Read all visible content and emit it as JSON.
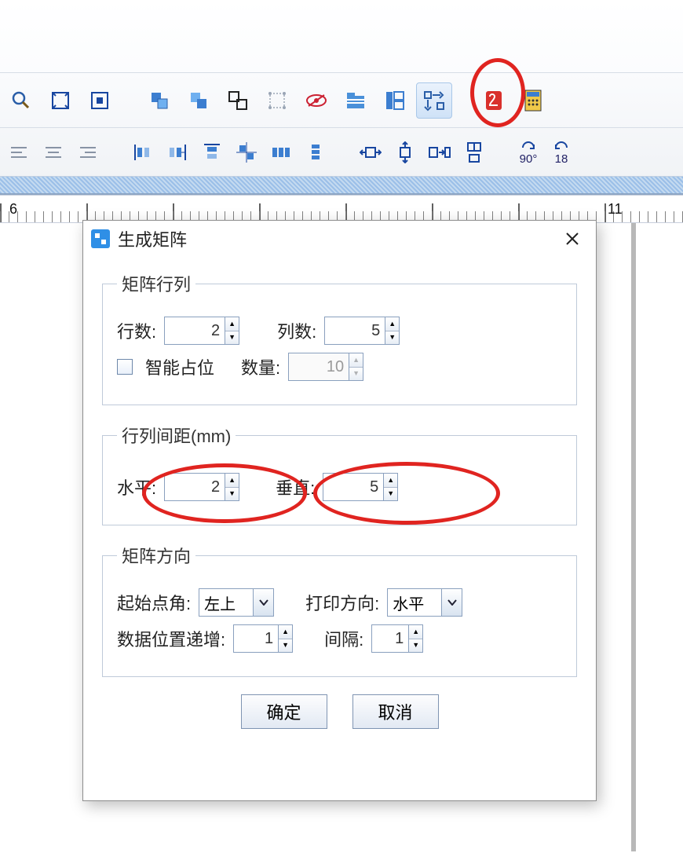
{
  "toolbar_icons_row1": [
    "magnifier-icon",
    "grid-expand-icon",
    "grid-target-icon",
    "sep",
    "copy-icon",
    "paste-icon",
    "group-icon",
    "transform-icon",
    "eye-icon",
    "folder-icon",
    "layout-icon",
    "matrix-icon",
    "sep",
    "pdf-icon",
    "calculator-icon"
  ],
  "toolbar_icons_row2": [
    "align-left-lines-icon",
    "align-center-lines-icon",
    "align-right-lines-icon",
    "sep",
    "distribute-h-icon",
    "distribute-h2-icon",
    "distribute-v-icon",
    "distribute-center-icon",
    "distribute-eq-icon",
    "distribute-eq2-icon",
    "sep",
    "center-h-icon",
    "center-v-icon",
    "same-width-icon",
    "same-height-icon",
    "sep",
    "rotate-90",
    "rotate-18"
  ],
  "rotate_labels": {
    "r90": "90°",
    "r18": "18"
  },
  "ruler": {
    "n6": "6",
    "n11": "11"
  },
  "dialog": {
    "title": "生成矩阵",
    "group_rowcol": {
      "legend": "矩阵行列",
      "rows_label": "行数:",
      "rows_value": "2",
      "cols_label": "列数:",
      "cols_value": "5",
      "smart_label": "智能占位",
      "qty_label": "数量:",
      "qty_value": "10"
    },
    "group_spacing": {
      "legend": "行列间距(mm)",
      "h_label": "水平:",
      "h_value": "2",
      "v_label": "垂直:",
      "v_value": "5"
    },
    "group_direction": {
      "legend": "矩阵方向",
      "start_label": "起始点角:",
      "start_value": "左上",
      "print_label": "打印方向:",
      "print_value": "水平",
      "incr_label": "数据位置递增:",
      "incr_value": "1",
      "interval_label": "间隔:",
      "interval_value": "1"
    },
    "ok": "确定",
    "cancel": "取消"
  }
}
